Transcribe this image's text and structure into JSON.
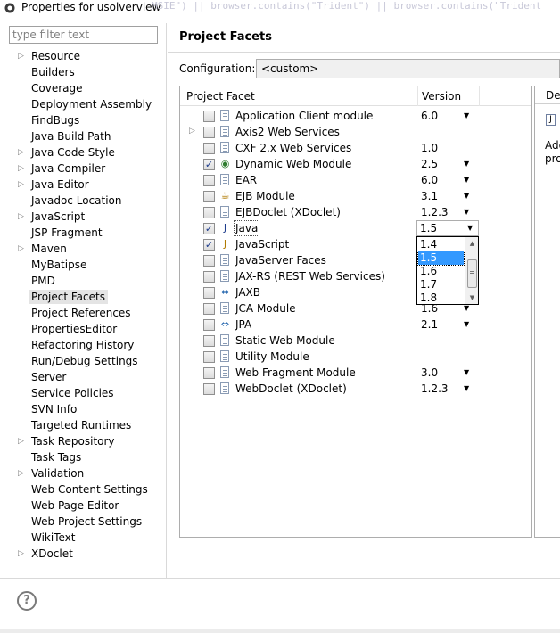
{
  "window": {
    "title": "Properties for usolverview",
    "ghost_text": "MSIE\") || browser.contains(\"Trident\") || browser.contains(\"Trident"
  },
  "filter": {
    "placeholder": "type filter text"
  },
  "tree": [
    {
      "label": "Resource",
      "expandable": true
    },
    {
      "label": "Builders",
      "expandable": false
    },
    {
      "label": "Coverage",
      "expandable": false
    },
    {
      "label": "Deployment Assembly",
      "expandable": false
    },
    {
      "label": "FindBugs",
      "expandable": false
    },
    {
      "label": "Java Build Path",
      "expandable": false
    },
    {
      "label": "Java Code Style",
      "expandable": true
    },
    {
      "label": "Java Compiler",
      "expandable": true
    },
    {
      "label": "Java Editor",
      "expandable": true
    },
    {
      "label": "Javadoc Location",
      "expandable": false
    },
    {
      "label": "JavaScript",
      "expandable": true
    },
    {
      "label": "JSP Fragment",
      "expandable": false
    },
    {
      "label": "Maven",
      "expandable": true
    },
    {
      "label": "MyBatipse",
      "expandable": false
    },
    {
      "label": "PMD",
      "expandable": false
    },
    {
      "label": "Project Facets",
      "expandable": false,
      "selected": true
    },
    {
      "label": "Project References",
      "expandable": false
    },
    {
      "label": "PropertiesEditor",
      "expandable": false
    },
    {
      "label": "Refactoring History",
      "expandable": false
    },
    {
      "label": "Run/Debug Settings",
      "expandable": false
    },
    {
      "label": "Server",
      "expandable": false
    },
    {
      "label": "Service Policies",
      "expandable": false
    },
    {
      "label": "SVN Info",
      "expandable": false
    },
    {
      "label": "Targeted Runtimes",
      "expandable": false
    },
    {
      "label": "Task Repository",
      "expandable": true
    },
    {
      "label": "Task Tags",
      "expandable": false
    },
    {
      "label": "Validation",
      "expandable": true
    },
    {
      "label": "Web Content Settings",
      "expandable": false
    },
    {
      "label": "Web Page Editor",
      "expandable": false
    },
    {
      "label": "Web Project Settings",
      "expandable": false
    },
    {
      "label": "WikiText",
      "expandable": false
    },
    {
      "label": "XDoclet",
      "expandable": true
    }
  ],
  "page": {
    "title": "Project Facets",
    "configuration_label": "Configuration:",
    "configuration_value": "<custom>"
  },
  "table": {
    "col_facet": "Project Facet",
    "col_version": "Version",
    "rows": [
      {
        "name": "Application Client module",
        "version": "6.0",
        "checked": false,
        "icon": "doc",
        "dropdown": true
      },
      {
        "name": "Axis2 Web Services",
        "version": "",
        "checked": false,
        "icon": "doc",
        "dropdown": false,
        "expandable": true
      },
      {
        "name": "CXF 2.x Web Services",
        "version": "1.0",
        "checked": false,
        "icon": "doc",
        "dropdown": false
      },
      {
        "name": "Dynamic Web Module",
        "version": "2.5",
        "checked": true,
        "icon": "globe",
        "dropdown": true
      },
      {
        "name": "EAR",
        "version": "6.0",
        "checked": false,
        "icon": "doc",
        "dropdown": true
      },
      {
        "name": "EJB Module",
        "version": "3.1",
        "checked": false,
        "icon": "bean",
        "dropdown": true
      },
      {
        "name": "EJBDoclet (XDoclet)",
        "version": "1.2.3",
        "checked": false,
        "icon": "doc",
        "dropdown": true
      },
      {
        "name": "Java",
        "version": "1.5",
        "checked": true,
        "icon": "java",
        "dropdown": true,
        "active": true
      },
      {
        "name": "JavaScript",
        "version": "",
        "checked": true,
        "icon": "js",
        "dropdown": false
      },
      {
        "name": "JavaServer Faces",
        "version": "",
        "checked": false,
        "icon": "doc",
        "dropdown": false
      },
      {
        "name": "JAX-RS (REST Web Services)",
        "version": "",
        "checked": false,
        "icon": "doc",
        "dropdown": false
      },
      {
        "name": "JAXB",
        "version": "",
        "checked": false,
        "icon": "arrows",
        "dropdown": false
      },
      {
        "name": "JCA Module",
        "version": "1.6",
        "checked": false,
        "icon": "doc",
        "dropdown": true
      },
      {
        "name": "JPA",
        "version": "2.1",
        "checked": false,
        "icon": "arrows",
        "dropdown": true
      },
      {
        "name": "Static Web Module",
        "version": "",
        "checked": false,
        "icon": "doc",
        "dropdown": false
      },
      {
        "name": "Utility Module",
        "version": "",
        "checked": false,
        "icon": "doc",
        "dropdown": false
      },
      {
        "name": "Web Fragment Module",
        "version": "3.0",
        "checked": false,
        "icon": "doc",
        "dropdown": true
      },
      {
        "name": "WebDoclet (XDoclet)",
        "version": "1.2.3",
        "checked": false,
        "icon": "doc",
        "dropdown": true
      }
    ]
  },
  "version_dropdown": {
    "options": [
      "1.4",
      "1.5",
      "1.6",
      "1.7",
      "1.8"
    ],
    "selected_index": 1
  },
  "details": {
    "tab_label": "Details",
    "text_line1": "Add",
    "text_line2": "pro"
  },
  "help": {
    "glyph": "?"
  },
  "colors": {
    "selection": "#3399ff",
    "tree_selected": "#e4e4e4"
  }
}
